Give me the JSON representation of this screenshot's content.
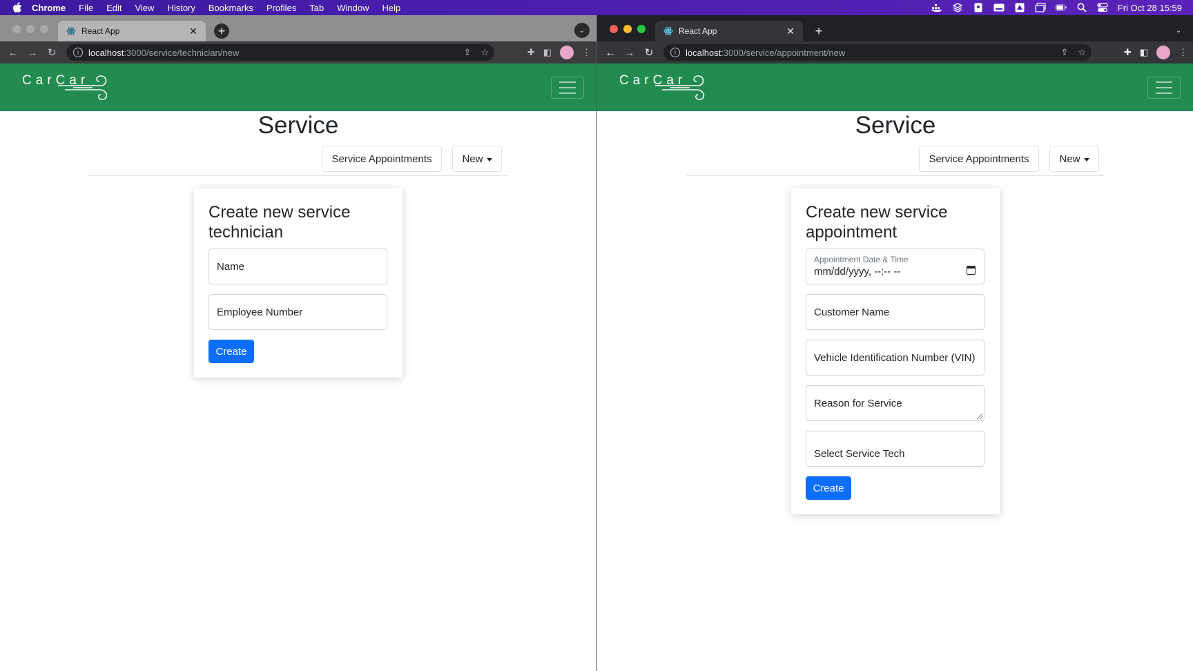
{
  "menubar": {
    "app_name": "Chrome",
    "items": [
      "File",
      "Edit",
      "View",
      "History",
      "Bookmarks",
      "Profiles",
      "Tab",
      "Window",
      "Help"
    ],
    "clock": "Fri Oct 28  15:59"
  },
  "left_window": {
    "tab_title": "React App",
    "url_host": "localhost",
    "url_path": ":3000/service/technician/new",
    "app": {
      "logo_text": "CarCar",
      "page_title": "Service",
      "nav": {
        "appointments_label": "Service Appointments",
        "new_label": "New"
      },
      "form": {
        "heading": "Create new service technician",
        "name_placeholder": "Name",
        "employee_number_placeholder": "Employee Number",
        "submit_label": "Create"
      }
    }
  },
  "right_window": {
    "tab_title": "React App",
    "url_host": "localhost",
    "url_path": ":3000/service/appointment/new",
    "app": {
      "logo_text": "CarCar",
      "page_title": "Service",
      "nav": {
        "appointments_label": "Service Appointments",
        "new_label": "New"
      },
      "form": {
        "heading": "Create new service appointment",
        "datetime_label": "Appointment Date & Time",
        "datetime_value": "mm/dd/yyyy, --:-- --",
        "customer_name_placeholder": "Customer Name",
        "vin_placeholder": "Vehicle Identification Number (VIN)",
        "reason_placeholder": "Reason for Service",
        "tech_select_value": "Select Service Tech",
        "submit_label": "Create"
      }
    }
  },
  "colors": {
    "navbar_green": "#228b4f",
    "primary_button": "#0d6efd",
    "menubar_purple": "#4b1fb0"
  }
}
